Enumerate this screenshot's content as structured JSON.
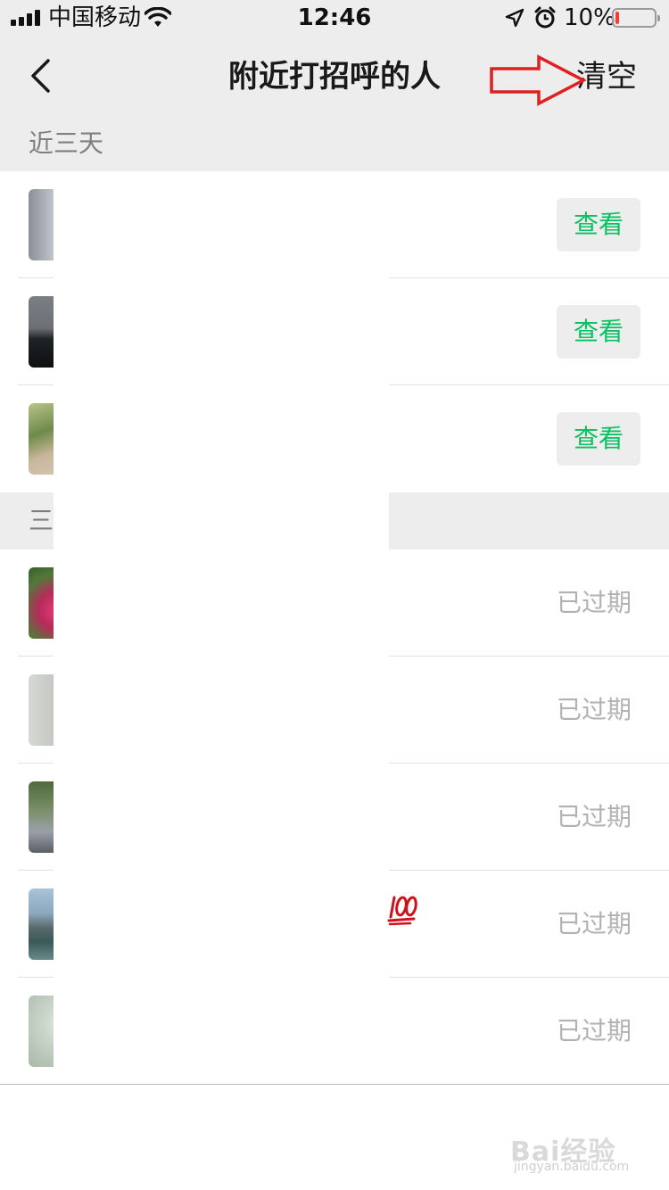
{
  "status_bar": {
    "carrier": "中国移动",
    "time": "12:46",
    "battery_percent": "10%",
    "battery_level": 0.1,
    "battery_color": "#ff3b30",
    "icons": [
      "signal-icon",
      "wifi-icon",
      "location-arrow-icon",
      "alarm-icon",
      "battery-icon"
    ]
  },
  "nav": {
    "back_icon": "chevron-left-icon",
    "title": "附近打招呼的人",
    "clear_label": "清空",
    "annotation_arrow_color": "#e02020"
  },
  "sections": [
    {
      "header": "近三天",
      "items": [
        {
          "action_label": "查看"
        },
        {
          "action_label": "查看"
        },
        {
          "action_label": "查看"
        }
      ]
    },
    {
      "header": "三",
      "items": [
        {
          "status_label": "已过期"
        },
        {
          "status_label": "已过期"
        },
        {
          "status_label": "已过期"
        },
        {
          "status_label": "已过期"
        },
        {
          "status_label": "已过期"
        }
      ]
    }
  ],
  "colors": {
    "accent_green": "#07c160",
    "background_gray": "#ededed",
    "muted_text": "#b2b2b2"
  },
  "watermark": {
    "brand": "Bai经验",
    "url": "jingyan.baidu.com"
  }
}
